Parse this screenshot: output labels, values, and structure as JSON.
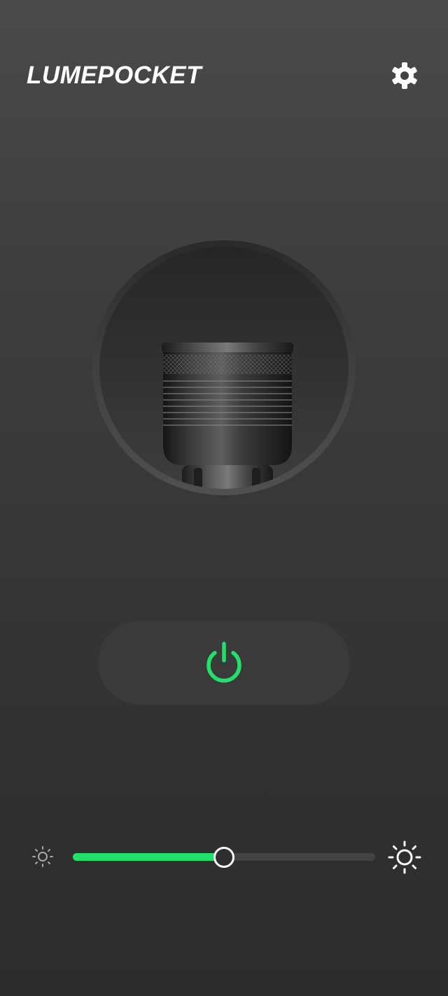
{
  "header": {
    "title": "LUMEPOCKET",
    "settings_icon": "gear-icon"
  },
  "flashlight": {
    "image": "flashlight-head-image"
  },
  "power": {
    "icon": "power-icon",
    "state": "on",
    "accent_color": "#22e06a"
  },
  "brightness": {
    "min_icon": "sun-small-icon",
    "max_icon": "sun-large-icon",
    "level": 0.5,
    "fill_color": "#22e06a",
    "track_color": "#434343"
  }
}
